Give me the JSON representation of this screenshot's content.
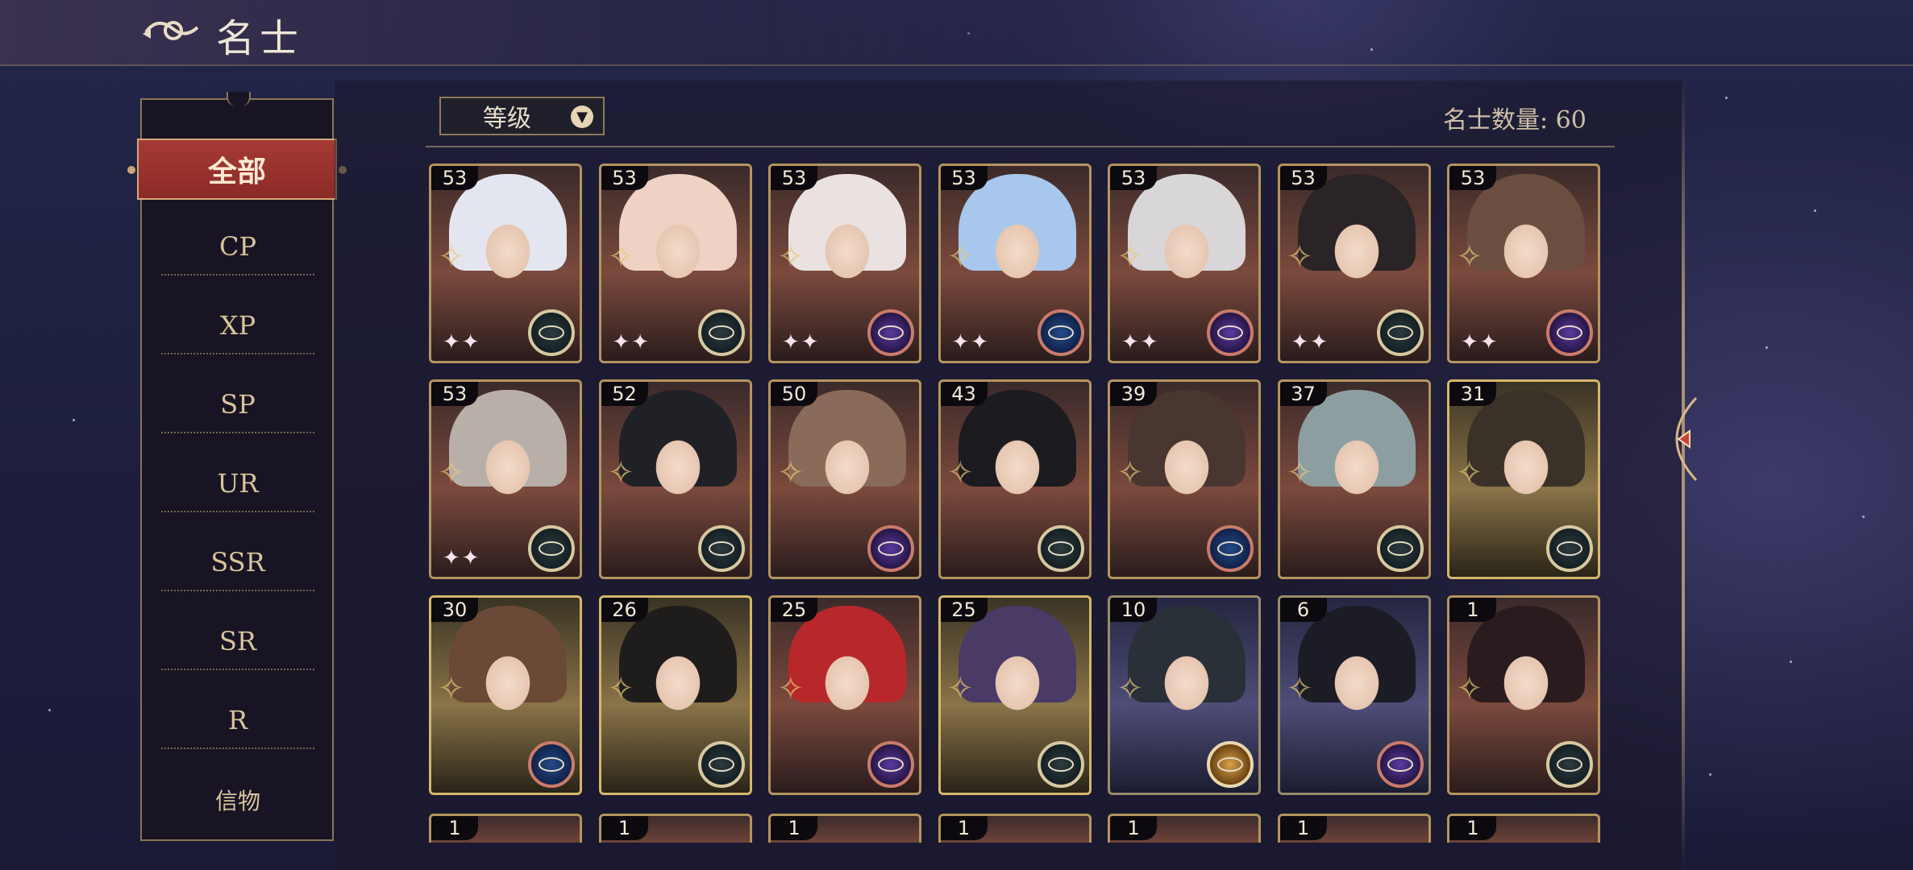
{
  "header": {
    "title": "名士"
  },
  "sort": {
    "label": "等级"
  },
  "count_label": "名士数量: 60",
  "categories": {
    "active": "全部",
    "items": [
      "CP",
      "XP",
      "SP",
      "UR",
      "SSR",
      "SR",
      "R",
      "信物"
    ]
  },
  "cards": [
    {
      "level": "53",
      "emblem": "gray",
      "hair": "#e4e6ef",
      "sparkles": "✦✦"
    },
    {
      "level": "53",
      "emblem": "gray",
      "hair": "#efd2c4",
      "sparkles": "✦✦"
    },
    {
      "level": "53",
      "emblem": "purple",
      "hair": "#e9e2e0",
      "sparkles": "✦✦"
    },
    {
      "level": "53",
      "emblem": "blue",
      "hair": "#a8c7ec",
      "sparkles": "✦✦"
    },
    {
      "level": "53",
      "emblem": "purple",
      "hair": "#d8d6d8",
      "sparkles": "✦✦"
    },
    {
      "level": "53",
      "emblem": "gray",
      "hair": "#2a2426",
      "sparkles": "✦✦"
    },
    {
      "level": "53",
      "emblem": "purple",
      "hair": "#6b4e3f",
      "sparkles": "✦✦"
    },
    {
      "level": "53",
      "emblem": "gray",
      "hair": "#b8b0a8",
      "sparkles": "✦✦"
    },
    {
      "level": "52",
      "emblem": "gray",
      "hair": "#1f2126",
      "sparkles": ""
    },
    {
      "level": "50",
      "emblem": "purple",
      "hair": "#8a6a58",
      "sparkles": ""
    },
    {
      "level": "43",
      "emblem": "gray",
      "hair": "#1c1b20",
      "sparkles": ""
    },
    {
      "level": "39",
      "emblem": "blue",
      "hair": "#4a3630",
      "sparkles": ""
    },
    {
      "level": "37",
      "emblem": "gray",
      "hair": "#8c9ea0",
      "sparkles": ""
    },
    {
      "level": "31",
      "emblem": "gray",
      "hair": "#3a3228",
      "sparkles": "",
      "style": "gold"
    },
    {
      "level": "30",
      "emblem": "blue",
      "hair": "#6a4a36",
      "sparkles": "",
      "style": "gold"
    },
    {
      "level": "26",
      "emblem": "gray",
      "hair": "#1f1c1c",
      "sparkles": "",
      "style": "gold"
    },
    {
      "level": "25",
      "emblem": "purple",
      "hair": "#b8282a",
      "sparkles": ""
    },
    {
      "level": "25",
      "emblem": "gray",
      "hair": "#4a3a66",
      "sparkles": "",
      "style": "gold"
    },
    {
      "level": "10",
      "emblem": "gold",
      "hair": "#2a3038",
      "sparkles": "",
      "style": "dark"
    },
    {
      "level": "6",
      "emblem": "purple",
      "hair": "#1c1c24",
      "sparkles": "",
      "style": "dark"
    },
    {
      "level": "1",
      "emblem": "gray",
      "hair": "#2a1c1e",
      "sparkles": ""
    }
  ],
  "partial_row": [
    "1",
    "1",
    "1",
    "1",
    "1",
    "1",
    "1"
  ]
}
